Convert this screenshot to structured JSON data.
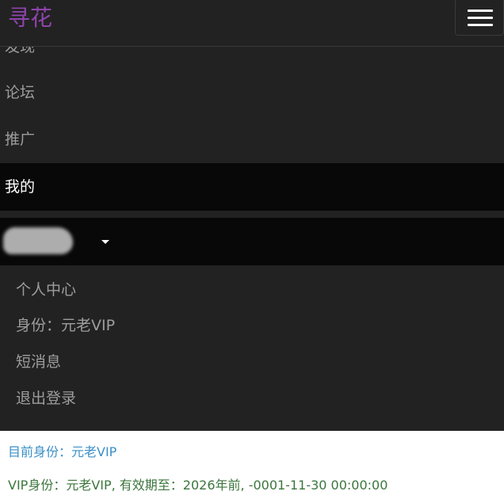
{
  "navbar": {
    "brand": "寻花",
    "menu": [
      {
        "label": "发现"
      },
      {
        "label": "论坛"
      },
      {
        "label": "推广"
      },
      {
        "label": "我的"
      }
    ]
  },
  "user_dropdown": {
    "items": [
      {
        "label": "个人中心"
      },
      {
        "label": "身份：元老VIP"
      },
      {
        "label": "短消息"
      },
      {
        "label": "退出登录"
      }
    ]
  },
  "status": {
    "current_identity": "目前身份：元老VIP",
    "vip_info": "VIP身份：元老VIP, 有效期至：2026年前, -0001-11-30 00:00:00"
  },
  "colors": {
    "brand": "#8e44ad",
    "navbar_bg": "#222222",
    "active_bg": "#080808",
    "menu_text": "#9d9d9d",
    "info_blue": "#3a8fc7",
    "info_green": "#3c763d"
  },
  "icons": {
    "menu_toggle": "hamburger-icon",
    "dropdown": "caret-down-icon"
  }
}
